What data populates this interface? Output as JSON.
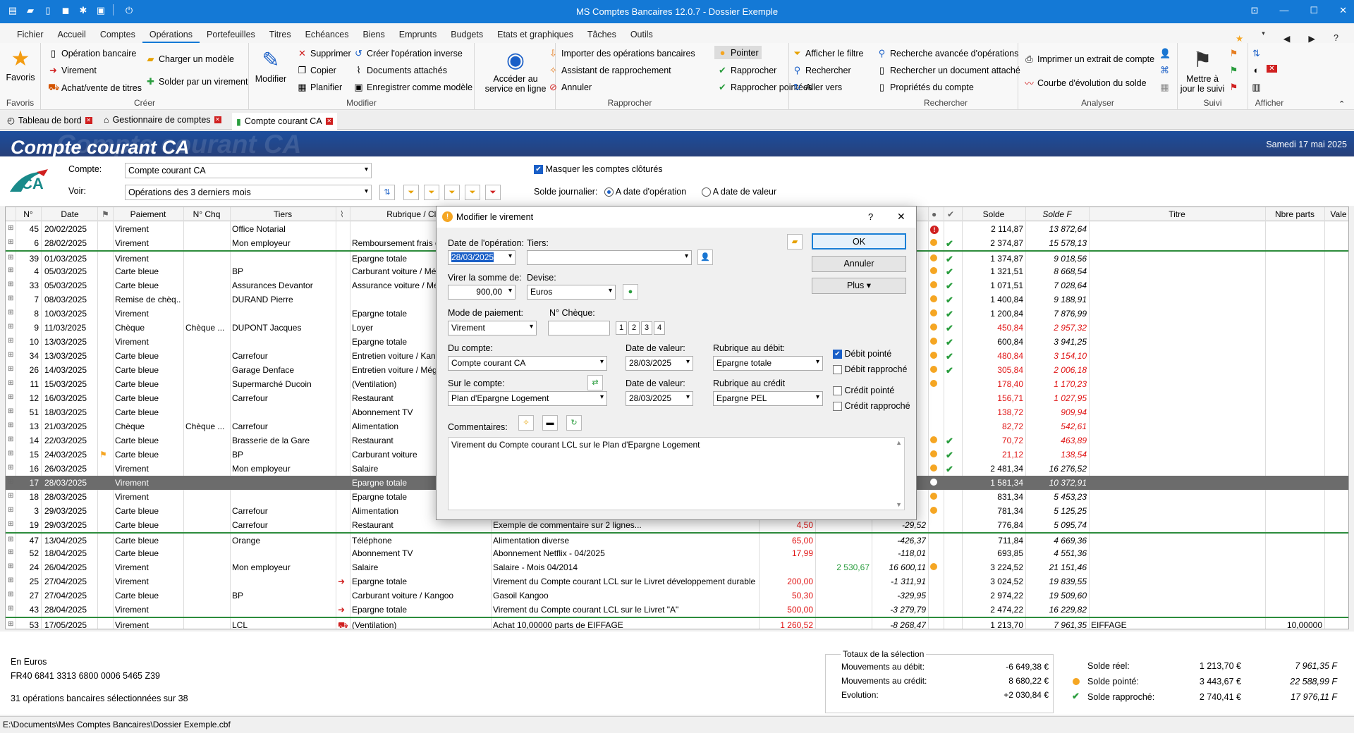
{
  "app": {
    "title": "MS Comptes Bancaires 12.0.7 - Dossier Exemple"
  },
  "menu": [
    "Fichier",
    "Accueil",
    "Comptes",
    "Opérations",
    "Portefeuilles",
    "Titres",
    "Echéances",
    "Biens",
    "Emprunts",
    "Budgets",
    "Etats et graphiques",
    "Tâches",
    "Outils"
  ],
  "menu_active": "Opérations",
  "ribbon": {
    "favoris": {
      "label": "Favoris",
      "group": "Favoris"
    },
    "creer": {
      "group": "Créer",
      "items": [
        "Opération bancaire",
        "Virement",
        "Achat/vente de titres",
        "Charger un modèle",
        "Solder par un virement"
      ]
    },
    "modifier": {
      "group": "Modifier",
      "big": "Modifier",
      "items": [
        "Supprimer",
        "Copier",
        "Planifier",
        "Créer l'opération inverse",
        "Documents attachés",
        "Enregistrer comme modèle"
      ]
    },
    "rapprocher": {
      "group": "Rapprocher",
      "big": "Accéder au service en ligne",
      "items": [
        "Importer des opérations bancaires",
        "Assistant de rapprochement",
        "Annuler",
        "Pointer",
        "Rapprocher",
        "Rapprocher pointées"
      ]
    },
    "rechercher": {
      "group": "Rechercher",
      "items": [
        "Afficher le filtre",
        "Rechercher",
        "Aller vers",
        "Recherche avancée d'opérations",
        "Rechercher un document attaché",
        "Propriétés du compte"
      ]
    },
    "analyser": {
      "group": "Analyser",
      "items": [
        "Imprimer un extrait de compte",
        "Courbe d'évolution du solde"
      ]
    },
    "suivi": {
      "group": "Suivi",
      "big": "Mettre à jour le suivi"
    },
    "afficher": {
      "group": "Afficher"
    }
  },
  "doc_tabs": [
    "Tableau de bord",
    "Gestionnaire de comptes",
    "Compte courant CA"
  ],
  "header": {
    "title": "Compte courant CA",
    "date": "Samedi 17 mai 2025"
  },
  "filters": {
    "compte_label": "Compte:",
    "compte_value": "Compte courant CA",
    "voir_label": "Voir:",
    "voir_value": "Opérations des 3 derniers mois",
    "masquer_label": "Masquer les comptes clôturés",
    "solde_label": "Solde journalier:",
    "radio1": "A date d'opération",
    "radio2": "A date de valeur"
  },
  "columns": [
    "N°",
    "Date",
    "Paiement",
    "N° Chq",
    "Tiers",
    "Rubrique / Classe",
    "Solde",
    "Solde F",
    "Titre",
    "Nbre parts",
    "Vale"
  ],
  "rows": [
    {
      "n": "45",
      "date": "20/02/2025",
      "pay": "Virement",
      "chq": "",
      "tiers": "Office Notarial",
      "rub": "",
      "solde": "2 114,87",
      "soldef": "13 872,64",
      "status": "alert"
    },
    {
      "n": "6",
      "date": "28/02/2025",
      "pay": "Virement",
      "chq": "",
      "tiers": "Mon employeur",
      "rub": "Remboursement frais déplace",
      "solde": "2 374,87",
      "soldef": "15 578,13",
      "status": "dotcheck"
    },
    {
      "n": "39",
      "date": "01/03/2025",
      "pay": "Virement",
      "chq": "",
      "tiers": "",
      "rub": "Epargne totale",
      "solde": "1 374,87",
      "soldef": "9 018,56",
      "status": "dotcheck",
      "sep": true
    },
    {
      "n": "4",
      "date": "05/03/2025",
      "pay": "Carte bleue",
      "chq": "",
      "tiers": "BP",
      "rub": "Carburant voiture / Mégane",
      "solde": "1 321,51",
      "soldef": "8 668,54",
      "status": "dotcheck"
    },
    {
      "n": "33",
      "date": "05/03/2025",
      "pay": "Carte bleue",
      "chq": "",
      "tiers": "Assurances Devantor",
      "rub": "Assurance voiture / Mégane",
      "solde": "1 071,51",
      "soldef": "7 028,64",
      "status": "dotcheck"
    },
    {
      "n": "7",
      "date": "08/03/2025",
      "pay": "Remise de chèq...",
      "chq": "",
      "tiers": "DURAND Pierre",
      "rub": "",
      "solde": "1 400,84",
      "soldef": "9 188,91",
      "status": "dotcheck"
    },
    {
      "n": "8",
      "date": "10/03/2025",
      "pay": "Virement",
      "chq": "",
      "tiers": "",
      "rub": "Epargne totale",
      "solde": "1 200,84",
      "soldef": "7 876,99",
      "status": "dotcheck"
    },
    {
      "n": "9",
      "date": "11/03/2025",
      "pay": "Chèque",
      "chq": "Chèque ...",
      "tiers": "DUPONT Jacques",
      "rub": "Loyer",
      "solde": "450,84",
      "soldef": "2 957,32",
      "status": "dotcheck",
      "red": true
    },
    {
      "n": "10",
      "date": "13/03/2025",
      "pay": "Virement",
      "chq": "",
      "tiers": "",
      "rub": "Epargne totale",
      "solde": "600,84",
      "soldef": "3 941,25",
      "status": "dotcheck"
    },
    {
      "n": "34",
      "date": "13/03/2025",
      "pay": "Carte bleue",
      "chq": "",
      "tiers": "Carrefour",
      "rub": "Entretien voiture / Kangoo",
      "solde": "480,84",
      "soldef": "3 154,10",
      "status": "dotcheck",
      "red": true
    },
    {
      "n": "26",
      "date": "14/03/2025",
      "pay": "Carte bleue",
      "chq": "",
      "tiers": "Garage Denface",
      "rub": "Entretien voiture / Mégane",
      "solde": "305,84",
      "soldef": "2 006,18",
      "status": "dotcheck",
      "red": true
    },
    {
      "n": "11",
      "date": "15/03/2025",
      "pay": "Carte bleue",
      "chq": "",
      "tiers": "Supermarché Ducoin",
      "rub": "(Ventilation)",
      "solde": "178,40",
      "soldef": "1 170,23",
      "status": "dot",
      "red": true
    },
    {
      "n": "12",
      "date": "16/03/2025",
      "pay": "Carte bleue",
      "chq": "",
      "tiers": "Carrefour",
      "rub": "Restaurant",
      "solde": "156,71",
      "soldef": "1 027,95",
      "status": "",
      "red": true
    },
    {
      "n": "51",
      "date": "18/03/2025",
      "pay": "Carte bleue",
      "chq": "",
      "tiers": "",
      "rub": "Abonnement TV",
      "solde": "138,72",
      "soldef": "909,94",
      "status": "",
      "red": true
    },
    {
      "n": "13",
      "date": "21/03/2025",
      "pay": "Chèque",
      "chq": "Chèque ...",
      "tiers": "Carrefour",
      "rub": "Alimentation",
      "solde": "82,72",
      "soldef": "542,61",
      "status": "",
      "red": true
    },
    {
      "n": "14",
      "date": "22/03/2025",
      "pay": "Carte bleue",
      "chq": "",
      "tiers": "Brasserie de la Gare",
      "rub": "Restaurant",
      "solde": "70,72",
      "soldef": "463,89",
      "status": "dotcheck",
      "red": true
    },
    {
      "n": "15",
      "date": "24/03/2025",
      "pay": "Carte bleue",
      "chq": "",
      "tiers": "BP",
      "rub": "Carburant voiture",
      "solde": "21,12",
      "soldef": "138,54",
      "status": "dotcheck",
      "red": true,
      "flag": true
    },
    {
      "n": "16",
      "date": "26/03/2025",
      "pay": "Virement",
      "chq": "",
      "tiers": "Mon employeur",
      "rub": "Salaire",
      "solde": "2 481,34",
      "soldef": "16 276,52",
      "status": "dotcheck"
    },
    {
      "n": "17",
      "date": "28/03/2025",
      "pay": "Virement",
      "chq": "",
      "tiers": "",
      "rub": "Epargne totale",
      "solde": "1 581,34",
      "soldef": "10 372,91",
      "status": "white",
      "sel": true
    },
    {
      "n": "18",
      "date": "28/03/2025",
      "pay": "Virement",
      "chq": "",
      "tiers": "",
      "rub": "Epargne totale",
      "solde": "831,34",
      "soldef": "5 453,23",
      "status": "dot"
    },
    {
      "n": "3",
      "date": "29/03/2025",
      "pay": "Carte bleue",
      "chq": "",
      "tiers": "Carrefour",
      "rub": "Alimentation",
      "solde": "781,34",
      "soldef": "5 125,25",
      "status": "dot"
    },
    {
      "n": "19",
      "date": "29/03/2025",
      "pay": "Carte bleue",
      "chq": "",
      "tiers": "Carrefour",
      "rub": "Restaurant",
      "comment": "Exemple de commentaire sur 2 lignes...",
      "debit": "4,50",
      "credit": "",
      "balance": "-29,52",
      "solde": "776,84",
      "soldef": "5 095,74",
      "status": ""
    },
    {
      "n": "47",
      "date": "13/04/2025",
      "pay": "Carte bleue",
      "chq": "",
      "tiers": "Orange",
      "rub": "Téléphone",
      "comment": "Alimentation diverse",
      "debit": "65,00",
      "credit": "",
      "balance": "-426,37",
      "solde": "711,84",
      "soldef": "4 669,36",
      "status": "",
      "sep": true
    },
    {
      "n": "52",
      "date": "18/04/2025",
      "pay": "Carte bleue",
      "chq": "",
      "tiers": "",
      "rub": "Abonnement TV",
      "comment": "Abonnement Netflix - 04/2025",
      "debit": "17,99",
      "credit": "",
      "balance": "-118,01",
      "solde": "693,85",
      "soldef": "4 551,36",
      "status": ""
    },
    {
      "n": "24",
      "date": "26/04/2025",
      "pay": "Virement",
      "chq": "",
      "tiers": "Mon employeur",
      "rub": "Salaire",
      "comment": "Salaire - Mois 04/2014",
      "debit": "",
      "credit": "2 530,67",
      "balance": "16 600,11",
      "solde": "3 224,52",
      "soldef": "21 151,46",
      "status": "dot"
    },
    {
      "n": "25",
      "date": "27/04/2025",
      "pay": "Virement",
      "chq": "",
      "tiers": "",
      "rub": "Epargne totale",
      "comment": "Virement du Compte courant LCL sur le Livret développement durable",
      "debit": "200,00",
      "credit": "",
      "balance": "-1 311,91",
      "solde": "3 024,52",
      "soldef": "19 839,55",
      "status": "",
      "arrow": true
    },
    {
      "n": "27",
      "date": "27/04/2025",
      "pay": "Carte bleue",
      "chq": "",
      "tiers": "BP",
      "rub": "Carburant voiture / Kangoo",
      "comment": "Gasoil Kangoo",
      "debit": "50,30",
      "credit": "",
      "balance": "-329,95",
      "solde": "2 974,22",
      "soldef": "19 509,60",
      "status": ""
    },
    {
      "n": "43",
      "date": "28/04/2025",
      "pay": "Virement",
      "chq": "",
      "tiers": "",
      "rub": "Epargne totale",
      "comment": "Virement du Compte courant LCL sur le Livret \"A\"",
      "debit": "500,00",
      "credit": "",
      "balance": "-3 279,79",
      "solde": "2 474,22",
      "soldef": "16 229,82",
      "status": "",
      "arrow": true
    },
    {
      "n": "53",
      "date": "17/05/2025",
      "pay": "Virement",
      "chq": "",
      "tiers": "LCL",
      "rub": "(Ventilation)",
      "comment": "Achat 10,00000 parts de EIFFAGE",
      "debit": "1 260,52",
      "credit": "",
      "balance": "-8 268,47",
      "solde": "1 213,70",
      "soldef": "7 961,35",
      "titre": "EIFFAGE",
      "parts": "10,00000",
      "status": "",
      "sep": true,
      "cart": true
    }
  ],
  "dialog": {
    "title": "Modifier le virement",
    "date_label": "Date de l'opération:",
    "date_value": "28/03/2025",
    "tiers_label": "Tiers:",
    "somme_label": "Virer la somme de:",
    "somme_value": "900,00",
    "devise_label": "Devise:",
    "devise_value": "Euros",
    "mode_label": "Mode de paiement:",
    "mode_value": "Virement",
    "chq_label": "N° Chèque:",
    "du_compte_label": "Du compte:",
    "du_compte_value": "Compte courant CA",
    "valeur1_label": "Date de valeur:",
    "valeur1_value": "28/03/2025",
    "rub_debit_label": "Rubrique au débit:",
    "rub_debit_value": "Epargne totale",
    "sur_compte_label": "Sur le compte:",
    "sur_compte_value": "Plan d'Epargne Logement",
    "valeur2_label": "Date de valeur:",
    "valeur2_value": "28/03/2025",
    "rub_credit_label": "Rubrique au crédit",
    "rub_credit_value": "Epargne PEL",
    "debit_pointe": "Débit pointé",
    "debit_rapproche": "Débit rapproché",
    "credit_pointe": "Crédit pointé",
    "credit_rapproche": "Crédit rapproché",
    "commentaires_label": "Commentaires:",
    "commentaire": "Virement du Compte courant LCL sur le Plan d'Epargne Logement",
    "ok": "OK",
    "annuler": "Annuler",
    "plus": "Plus ▾",
    "help": "?",
    "close": "✕"
  },
  "footer": {
    "devise": "En Euros",
    "iban": "FR40 6841 3313 6800 0006 5465 Z39",
    "selection": "31 opérations bancaires sélectionnées sur 38",
    "totaux_title": "Totaux de la sélection",
    "mvt_debit_label": "Mouvements au débit:",
    "mvt_debit": "-6 649,38 €",
    "mvt_credit_label": "Mouvements au crédit:",
    "mvt_credit": "8 680,22 €",
    "evolution_label": "Evolution:",
    "evolution": "+2 030,84 €",
    "solde_reel_label": "Solde réel:",
    "solde_reel": "1 213,70 €",
    "solde_reel_f": "7 961,35 F",
    "solde_pointe_label": "Solde pointé:",
    "solde_pointe": "3 443,67 €",
    "solde_pointe_f": "22 588,99 F",
    "solde_rapproche_label": "Solde rapproché:",
    "solde_rapproche": "2 740,41 €",
    "solde_rapproche_f": "17 976,11 F"
  },
  "status_path": "E:\\Documents\\Mes Comptes Bancaires\\Dossier Exemple.cbf"
}
